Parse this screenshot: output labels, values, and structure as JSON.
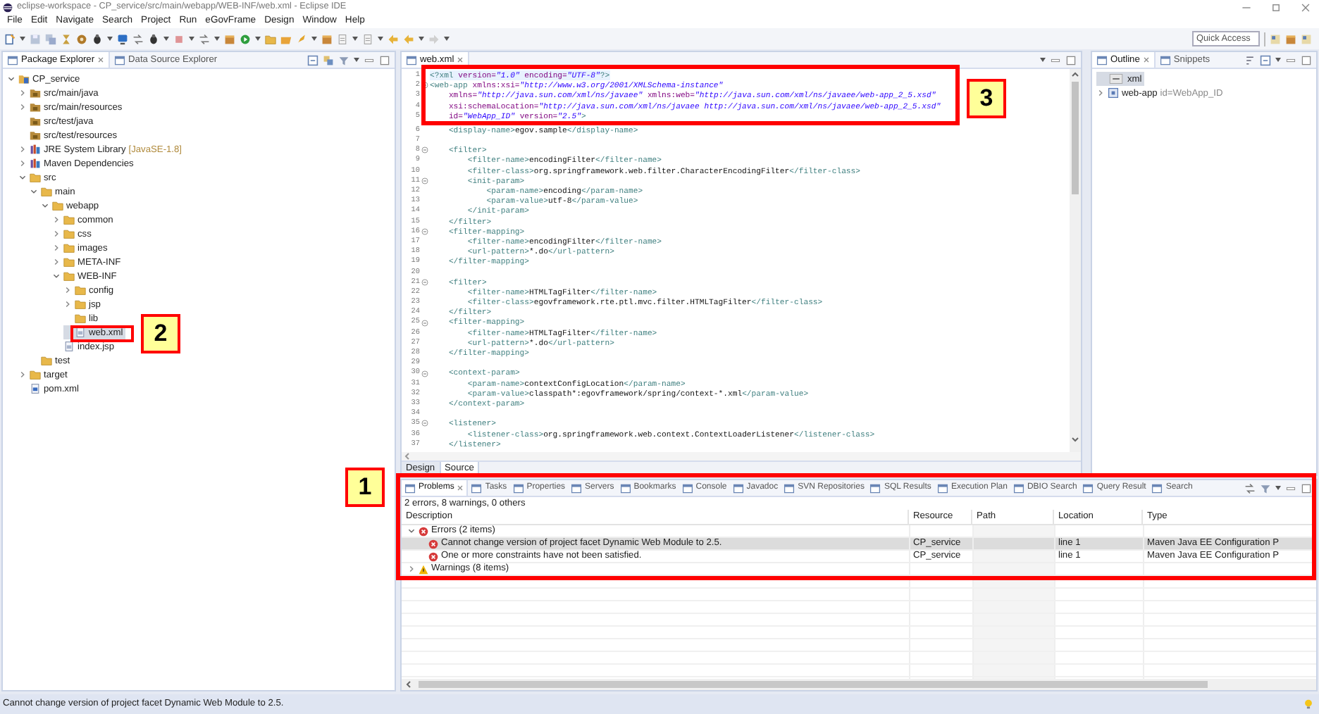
{
  "window": {
    "title": "eclipse-workspace - CP_service/src/main/webapp/WEB-INF/web.xml - Eclipse IDE"
  },
  "menu": [
    "File",
    "Edit",
    "Navigate",
    "Search",
    "Project",
    "Run",
    "eGovFrame",
    "Design",
    "Window",
    "Help"
  ],
  "quick_access": {
    "placeholder": "Quick Access"
  },
  "explorer": {
    "tabs": [
      {
        "label": "Package Explorer",
        "selected": true
      },
      {
        "label": "Data Source Explorer",
        "selected": false
      }
    ],
    "tree": [
      {
        "label": "CP_service",
        "kind": "project",
        "expanded": true,
        "selected": false,
        "children": [
          {
            "label": "src/main/java",
            "kind": "source-folder",
            "expanded": false,
            "selected": false
          },
          {
            "label": "src/main/resources",
            "kind": "source-folder",
            "expanded": false,
            "selected": false
          },
          {
            "label": "src/test/java",
            "kind": "source-folder",
            "selected": false
          },
          {
            "label": "src/test/resources",
            "kind": "source-folder",
            "selected": false
          },
          {
            "label": "JRE System Library",
            "decoration": "[JavaSE-1.8]",
            "kind": "library",
            "expanded": false,
            "selected": false
          },
          {
            "label": "Maven Dependencies",
            "kind": "library",
            "expanded": false,
            "selected": false
          },
          {
            "label": "src",
            "kind": "folder",
            "expanded": true,
            "selected": false,
            "children": [
              {
                "label": "main",
                "kind": "folder",
                "expanded": true,
                "selected": false,
                "children": [
                  {
                    "label": "webapp",
                    "kind": "folder",
                    "expanded": true,
                    "selected": false,
                    "children": [
                      {
                        "label": "common",
                        "kind": "folder",
                        "expanded": false,
                        "selected": false
                      },
                      {
                        "label": "css",
                        "kind": "folder",
                        "expanded": false,
                        "selected": false
                      },
                      {
                        "label": "images",
                        "kind": "folder",
                        "expanded": false,
                        "selected": false
                      },
                      {
                        "label": "META-INF",
                        "kind": "folder",
                        "expanded": false,
                        "selected": false
                      },
                      {
                        "label": "WEB-INF",
                        "kind": "folder",
                        "expanded": true,
                        "selected": false,
                        "children": [
                          {
                            "label": "config",
                            "kind": "folder",
                            "expanded": false,
                            "selected": false
                          },
                          {
                            "label": "jsp",
                            "kind": "folder",
                            "expanded": false,
                            "selected": false
                          },
                          {
                            "label": "lib",
                            "kind": "folder",
                            "selected": false
                          },
                          {
                            "label": "web.xml",
                            "kind": "xml-file",
                            "selected": true
                          }
                        ]
                      },
                      {
                        "label": "index.jsp",
                        "kind": "jsp-file",
                        "selected": false
                      }
                    ]
                  }
                ]
              },
              {
                "label": "test",
                "kind": "folder",
                "selected": false
              }
            ]
          },
          {
            "label": "target",
            "kind": "folder",
            "expanded": false,
            "selected": false
          },
          {
            "label": "pom.xml",
            "kind": "pom-file",
            "selected": false
          }
        ]
      }
    ]
  },
  "editor": {
    "tabs": [
      {
        "label": "web.xml",
        "selected": true
      }
    ],
    "lines": [
      {
        "number": "1",
        "fold": false,
        "current": true,
        "text": "<?xml version=\"1.0\" encoding=\"UTF-8\"?>"
      },
      {
        "number": "2",
        "fold": true,
        "current": false,
        "text": "<web-app xmlns:xsi=\"http://www.w3.org/2001/XMLSchema-instance\""
      },
      {
        "number": "3",
        "fold": false,
        "current": false,
        "text": "    xmlns=\"http://java.sun.com/xml/ns/javaee\" xmlns:web=\"http://java.sun.com/xml/ns/javaee/web-app_2_5.xsd\""
      },
      {
        "number": "4",
        "fold": false,
        "current": false,
        "text": "    xsi:schemaLocation=\"http://java.sun.com/xml/ns/javaee http://java.sun.com/xml/ns/javaee/web-app_2_5.xsd\""
      },
      {
        "number": "5",
        "fold": false,
        "current": false,
        "text": "    id=\"WebApp_ID\" version=\"2.5\">"
      },
      {
        "number": "6",
        "fold": false,
        "current": false,
        "text": "    <display-name>egov.sample</display-name>"
      },
      {
        "number": "7",
        "fold": false,
        "current": false
      },
      {
        "number": "8",
        "fold": true,
        "current": false,
        "text": "    <filter>"
      },
      {
        "number": "9",
        "fold": false,
        "current": false,
        "text": "        <filter-name>encodingFilter</filter-name>"
      },
      {
        "number": "10",
        "fold": false,
        "current": false,
        "text": "        <filter-class>org.springframework.web.filter.CharacterEncodingFilter</filter-class>"
      },
      {
        "number": "11",
        "fold": true,
        "current": false,
        "text": "        <init-param>"
      },
      {
        "number": "12",
        "fold": false,
        "current": false,
        "text": "            <param-name>encoding</param-name>"
      },
      {
        "number": "13",
        "fold": false,
        "current": false,
        "text": "            <param-value>utf-8</param-value>"
      },
      {
        "number": "14",
        "fold": false,
        "current": false,
        "text": "        </init-param>"
      },
      {
        "number": "15",
        "fold": false,
        "current": false,
        "text": "    </filter>"
      },
      {
        "number": "16",
        "fold": true,
        "current": false,
        "text": "    <filter-mapping>"
      },
      {
        "number": "17",
        "fold": false,
        "current": false,
        "text": "        <filter-name>encodingFilter</filter-name>"
      },
      {
        "number": "18",
        "fold": false,
        "current": false,
        "text": "        <url-pattern>*.do</url-pattern>"
      },
      {
        "number": "19",
        "fold": false,
        "current": false,
        "text": "    </filter-mapping>"
      },
      {
        "number": "20",
        "fold": false,
        "current": false
      },
      {
        "number": "21",
        "fold": true,
        "current": false,
        "text": "    <filter>"
      },
      {
        "number": "22",
        "fold": false,
        "current": false,
        "text": "        <filter-name>HTMLTagFilter</filter-name>"
      },
      {
        "number": "23",
        "fold": false,
        "current": false,
        "text": "        <filter-class>egovframework.rte.ptl.mvc.filter.HTMLTagFilter</filter-class>"
      },
      {
        "number": "24",
        "fold": false,
        "current": false,
        "text": "    </filter>"
      },
      {
        "number": "25",
        "fold": true,
        "current": false,
        "text": "    <filter-mapping>"
      },
      {
        "number": "26",
        "fold": false,
        "current": false,
        "text": "        <filter-name>HTMLTagFilter</filter-name>"
      },
      {
        "number": "27",
        "fold": false,
        "current": false,
        "text": "        <url-pattern>*.do</url-pattern>"
      },
      {
        "number": "28",
        "fold": false,
        "current": false,
        "text": "    </filter-mapping>"
      },
      {
        "number": "29",
        "fold": false,
        "current": false
      },
      {
        "number": "30",
        "fold": true,
        "current": false,
        "text": "    <context-param>"
      },
      {
        "number": "31",
        "fold": false,
        "current": false,
        "text": "        <param-name>contextConfigLocation</param-name>"
      },
      {
        "number": "32",
        "fold": false,
        "current": false,
        "text": "        <param-value>classpath*:egovframework/spring/context-*.xml</param-value>"
      },
      {
        "number": "33",
        "fold": false,
        "current": false,
        "text": "    </context-param>"
      },
      {
        "number": "34",
        "fold": false,
        "current": false
      },
      {
        "number": "35",
        "fold": true,
        "current": false,
        "text": "    <listener>"
      },
      {
        "number": "36",
        "fold": false,
        "current": false,
        "text": "        <listener-class>org.springframework.web.context.ContextLoaderListener</listener-class>"
      },
      {
        "number": "37",
        "fold": false,
        "current": false,
        "text": "    </listener>"
      }
    ],
    "bottom_tabs": [
      {
        "label": "Design",
        "selected": false
      },
      {
        "label": "Source",
        "selected": true
      }
    ]
  },
  "outline": {
    "tabs": [
      {
        "label": "Outline",
        "selected": true
      },
      {
        "label": "Snippets",
        "selected": false
      }
    ],
    "items": [
      {
        "label": "xml",
        "kind": "instruction",
        "selected": true
      },
      {
        "label": "web-app",
        "detail": "id=WebApp_ID",
        "kind": "element",
        "expanded": false,
        "selected": false
      }
    ]
  },
  "problems": {
    "tabs": [
      {
        "label": "Problems",
        "selected": true
      },
      {
        "label": "Tasks",
        "selected": false
      },
      {
        "label": "Properties",
        "selected": false
      },
      {
        "label": "Servers",
        "selected": false
      },
      {
        "label": "Bookmarks",
        "selected": false
      },
      {
        "label": "Console",
        "selected": false
      },
      {
        "label": "Javadoc",
        "selected": false
      },
      {
        "label": "SVN Repositories",
        "selected": false
      },
      {
        "label": "SQL Results",
        "selected": false
      },
      {
        "label": "Execution Plan",
        "selected": false
      },
      {
        "label": "DBIO Search",
        "selected": false
      },
      {
        "label": "Query Result",
        "selected": false
      },
      {
        "label": "Search",
        "selected": false
      }
    ],
    "summary": "2 errors, 8 warnings, 0 others",
    "columns": [
      "Description",
      "Resource",
      "Path",
      "Location",
      "Type"
    ],
    "groups": [
      {
        "label": "Errors (2 items)",
        "kind": "error",
        "expanded": true,
        "rows": [
          {
            "description": "Cannot change version of project facet Dynamic Web Module to 2.5.",
            "resource": "CP_service",
            "location": "line 1",
            "type": "Maven Java EE Configuration P",
            "selected": true
          },
          {
            "description": "One or more constraints have not been satisfied.",
            "resource": "CP_service",
            "location": "line 1",
            "type": "Maven Java EE Configuration P",
            "selected": false
          }
        ]
      },
      {
        "label": "Warnings (8 items)",
        "kind": "warning",
        "expanded": false
      }
    ]
  },
  "status_bar": {
    "message": "Cannot change version of project facet Dynamic Web Module to 2.5."
  },
  "annotations": [
    {
      "label": "1"
    },
    {
      "label": "2"
    },
    {
      "label": "3"
    }
  ]
}
